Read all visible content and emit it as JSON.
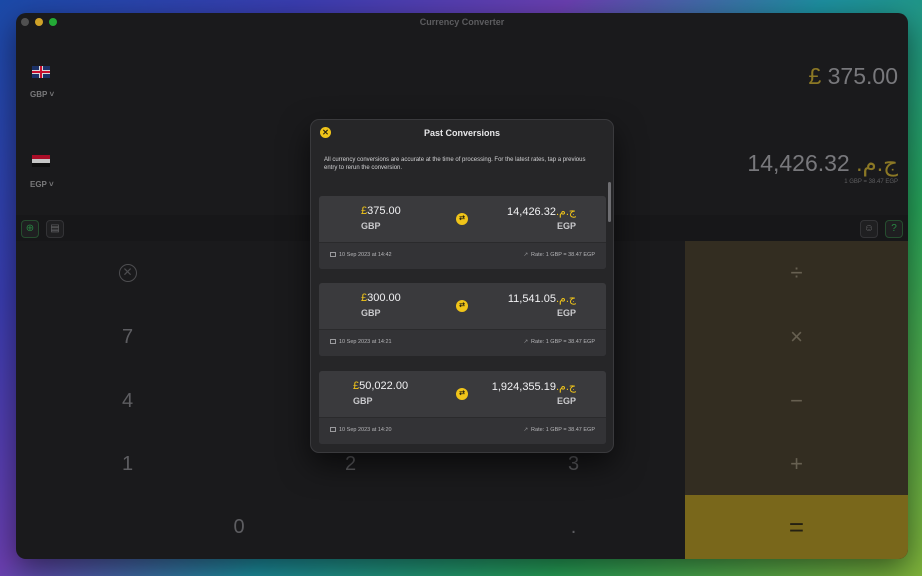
{
  "window": {
    "title": "Currency Converter"
  },
  "converter": {
    "from_code": "GBP",
    "from_symbol": "£",
    "from_amount": "375.00",
    "to_code": "EGP",
    "to_symbol": "ج.م.",
    "to_amount": "14,426.32",
    "rate_text": "1 GBP = 38.47 EGP"
  },
  "keypad": {
    "clear": "⊗",
    "keys": [
      "7",
      "4",
      "1",
      "2",
      "3",
      "0",
      "."
    ],
    "ops": [
      "÷",
      "×",
      "−",
      "+"
    ],
    "equals": "="
  },
  "toolbar": {
    "add_icon": "plus-circle-icon",
    "history_icon": "history-icon",
    "smile_icon": "smile-icon",
    "help_icon": "help-icon"
  },
  "modal": {
    "title": "Past Conversions",
    "info": "All currency conversions are accurate at the time of processing. For the latest rates, tap a previous entry to rerun the conversion.",
    "entries": [
      {
        "from_symbol": "£",
        "from_amount": "375.00",
        "from_code": "GBP",
        "to_symbol": "ج.م.",
        "to_amount": "14,426.32",
        "to_code": "EGP",
        "date": "10 Sep 2023 at 14:42",
        "rate": "Rate: 1 GBP = 38.47 EGP"
      },
      {
        "from_symbol": "£",
        "from_amount": "300.00",
        "from_code": "GBP",
        "to_symbol": "ج.م.",
        "to_amount": "11,541.05",
        "to_code": "EGP",
        "date": "10 Sep 2023 at 14:21",
        "rate": "Rate: 1 GBP = 38.47 EGP"
      },
      {
        "from_symbol": "£",
        "from_amount": "50,022.00",
        "from_code": "GBP",
        "to_symbol": "ج.م.",
        "to_amount": "1,924,355.19",
        "to_code": "EGP",
        "date": "10 Sep 2023 at 14:20",
        "rate": "Rate: 1 GBP = 38.47 EGP"
      }
    ]
  },
  "colors": {
    "accent": "#f0c419",
    "equals_bg": "#8f7a20"
  }
}
